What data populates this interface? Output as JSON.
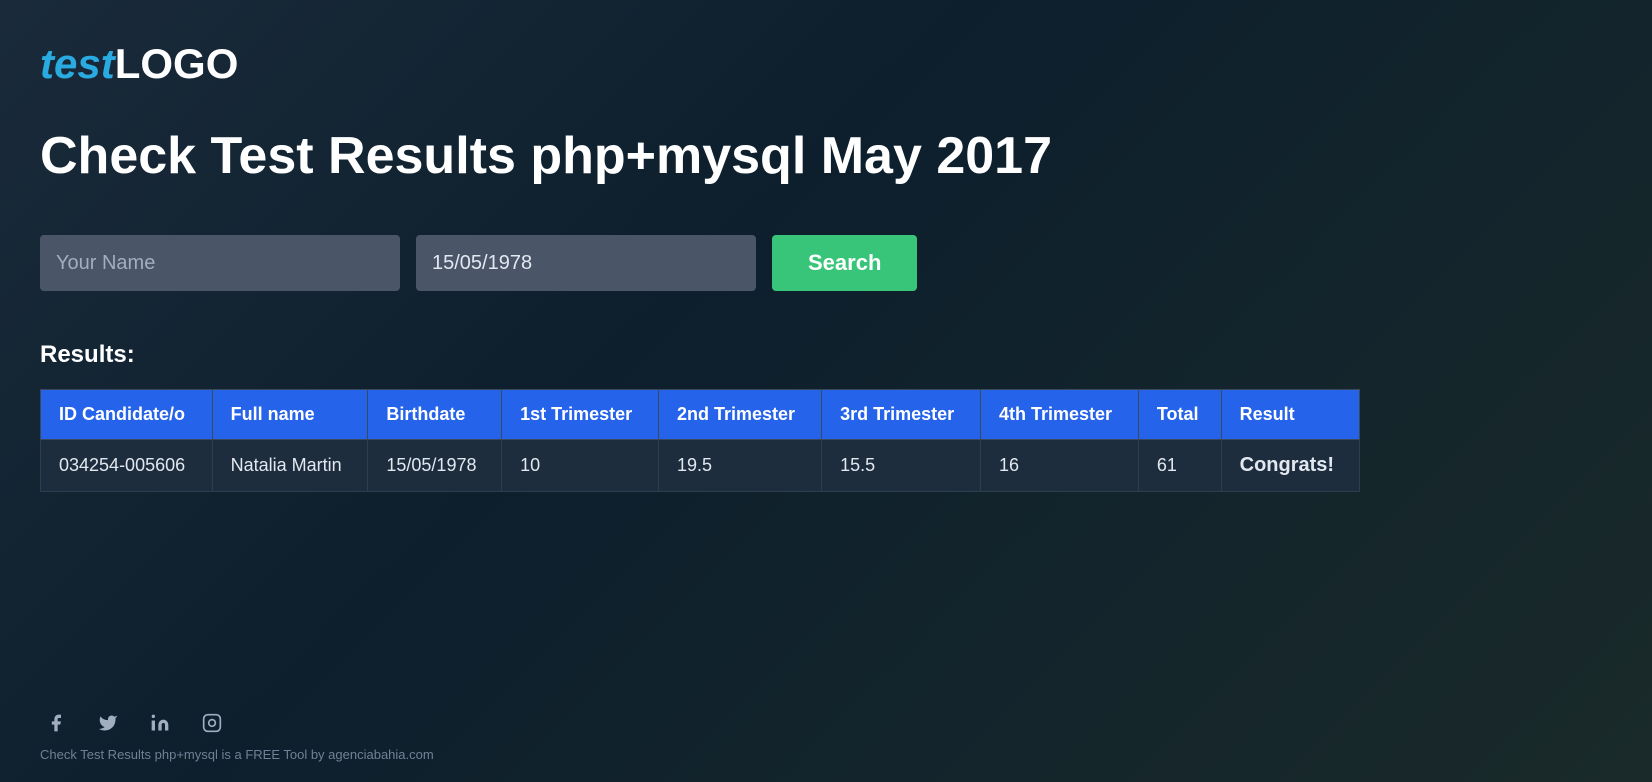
{
  "logo": {
    "test_part": "test",
    "logo_part": "LOGO"
  },
  "page": {
    "title": "Check Test Results php+mysql May 2017"
  },
  "search_form": {
    "name_placeholder": "Your Name",
    "name_value": "",
    "date_value": "15/05/1978",
    "button_label": "Search"
  },
  "results": {
    "label": "Results:",
    "columns": [
      "ID Candidate/o",
      "Full name",
      "Birthdate",
      "1st Trimester",
      "2nd Trimester",
      "3rd Trimester",
      "4th Trimester",
      "Total",
      "Result"
    ],
    "rows": [
      {
        "id": "034254-005606",
        "full_name": "Natalia Martin",
        "birthdate": "15/05/1978",
        "trim1": "10",
        "trim2": "19.5",
        "trim3": "15.5",
        "trim4": "16",
        "total": "61",
        "result": "Congrats!"
      }
    ]
  },
  "footer": {
    "text": "Check Test Results php+mysql is a FREE Tool by agenciabahia.com",
    "social": [
      {
        "name": "facebook",
        "icon": "f"
      },
      {
        "name": "twitter",
        "icon": "t"
      },
      {
        "name": "linkedin",
        "icon": "in"
      },
      {
        "name": "instagram",
        "icon": "ig"
      }
    ]
  }
}
